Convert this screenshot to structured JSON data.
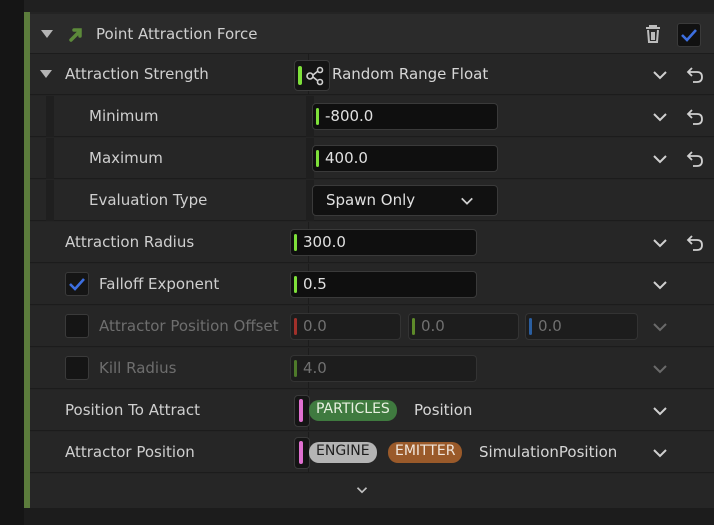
{
  "module": {
    "title": "Point Attraction Force"
  },
  "attraction_strength": {
    "label": "Attraction Strength",
    "mode": "Random Range Float",
    "minimum_label": "Minimum",
    "minimum_value": "-800.0",
    "maximum_label": "Maximum",
    "maximum_value": "400.0",
    "evaluation_label": "Evaluation Type",
    "evaluation_value": "Spawn Only"
  },
  "attraction_radius": {
    "label": "Attraction Radius",
    "value": "300.0"
  },
  "falloff_exponent": {
    "label": "Falloff Exponent",
    "value": "0.5",
    "enabled": true
  },
  "attractor_position_offset": {
    "label": "Attractor Position Offset",
    "x": "0.0",
    "y": "0.0",
    "z": "0.0",
    "enabled": false
  },
  "kill_radius": {
    "label": "Kill Radius",
    "value": "4.0",
    "enabled": false
  },
  "position_to_attract": {
    "label": "Position To Attract",
    "namespace": "PARTICLES",
    "attribute": "Position"
  },
  "attractor_position": {
    "label": "Attractor Position",
    "namespace1": "ENGINE",
    "namespace2": "EMITTER",
    "attribute": "SimulationPosition"
  },
  "colors": {
    "float_pin": "#7ee03a",
    "x_axis": "#a0302a",
    "y_axis": "#5e8a2a",
    "z_axis": "#2a5ea0",
    "struct_pin": "#e070d0",
    "particles_pill": "#3f7a3f",
    "engine_pill": "#b4b4b4",
    "emitter_pill": "#9a5a2a",
    "checkbox_accent": "#3d6fe0",
    "module_accent": "#5c7c3c"
  }
}
